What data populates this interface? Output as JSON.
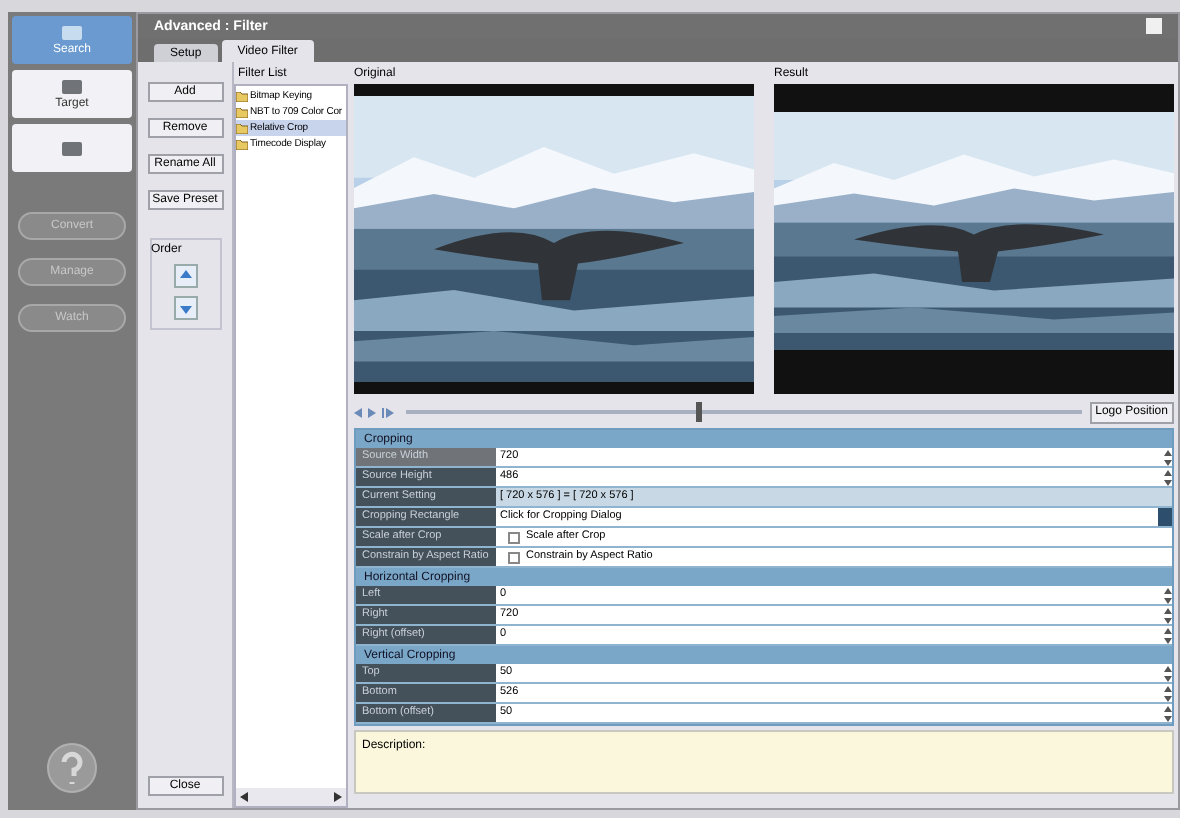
{
  "sidebar": {
    "items": [
      {
        "label": "Search",
        "selected": true
      },
      {
        "label": "Target",
        "selected": false
      },
      {
        "selected": false
      }
    ],
    "actions": [
      {
        "label": "Convert"
      },
      {
        "label": "Manage"
      },
      {
        "label": "Watch"
      }
    ]
  },
  "window": {
    "title": "Advanced : Filter"
  },
  "tabs": [
    {
      "label": "Setup",
      "selected": false
    },
    {
      "label": "Video Filter",
      "selected": true
    }
  ],
  "buttons": [
    "Add",
    "Remove",
    "Rename All",
    "Save Preset"
  ],
  "order": {
    "label": "Order"
  },
  "close_button": "Close",
  "filter_list": {
    "title": "Filter List",
    "items": [
      {
        "label": "Bitmap Keying",
        "selected": false
      },
      {
        "label": "NBT to 709 Color Cor",
        "selected": false
      },
      {
        "label": "Relative Crop",
        "selected": true
      },
      {
        "label": "Timecode Display",
        "selected": false
      }
    ]
  },
  "preview": {
    "original_label": "Original",
    "result_label": "Result",
    "slider": {
      "level": 0.43
    },
    "logo_button": "Logo Position"
  },
  "properties": [
    {
      "section": "Cropping",
      "rows": [
        {
          "kind": "number",
          "name": "Source Width",
          "value": "720",
          "selected": true
        },
        {
          "kind": "number",
          "name": "Source Height",
          "value": "486",
          "selected": false
        },
        {
          "kind": "readonly",
          "name": "Current Setting",
          "value": "[ 720 x 576 ] = [ 720 x 576 ]",
          "selected": false
        },
        {
          "kind": "dialog",
          "name": "Cropping Rectangle",
          "value": "Click for Cropping Dialog",
          "selected": false
        },
        {
          "kind": "checkbox",
          "name": "Scale after Crop",
          "value": "Scale after Crop",
          "checked": false,
          "selected": false
        },
        {
          "kind": "checkbox",
          "name": "Constrain by Aspect Ratio",
          "value": "Constrain by Aspect Ratio",
          "checked": false,
          "selected": false
        }
      ]
    },
    {
      "section": "Horizontal Cropping",
      "rows": [
        {
          "kind": "number",
          "name": "Left",
          "value": "0",
          "selected": false
        },
        {
          "kind": "number",
          "name": "Right",
          "value": "720",
          "selected": false
        },
        {
          "kind": "number",
          "name": "Right (offset)",
          "value": "0",
          "selected": false
        }
      ]
    },
    {
      "section": "Vertical Cropping",
      "rows": [
        {
          "kind": "number",
          "name": "Top",
          "value": "50",
          "selected": false
        },
        {
          "kind": "number",
          "name": "Bottom",
          "value": "526",
          "selected": false
        },
        {
          "kind": "number",
          "name": "Bottom (offset)",
          "value": "50",
          "selected": false
        }
      ]
    }
  ],
  "description": {
    "label": "Description:"
  }
}
